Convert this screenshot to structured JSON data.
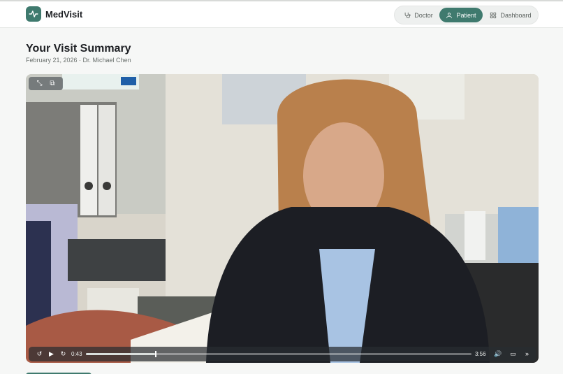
{
  "app": {
    "name": "MedVisit",
    "accent_color": "#3f7a6e"
  },
  "nav": {
    "items": [
      {
        "label": "Doctor",
        "icon": "stethoscope-icon"
      },
      {
        "label": "Patient",
        "icon": "user-icon",
        "active": true
      },
      {
        "label": "Dashboard",
        "icon": "grid-icon"
      }
    ]
  },
  "page": {
    "title": "Your Visit Summary",
    "subtitle": "February 21, 2026 · Dr. Michael Chen"
  },
  "video": {
    "current_time": "0:43",
    "duration": "3:56",
    "progress": 0.18,
    "toolbar": [
      "expand-icon",
      "picture-in-picture-icon"
    ],
    "controls": [
      "replay-10-icon",
      "play-icon",
      "forward-10-icon",
      "volume-icon",
      "cast-icon",
      "more-icon"
    ]
  }
}
